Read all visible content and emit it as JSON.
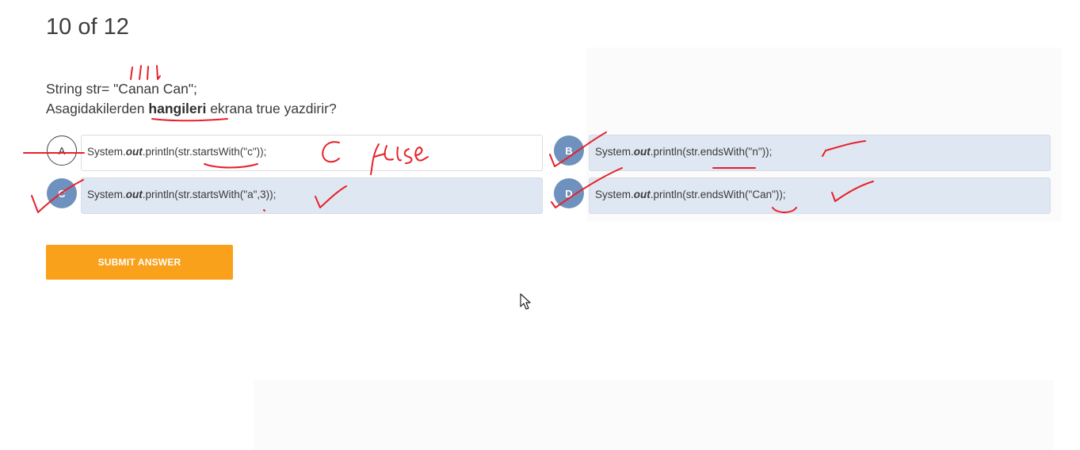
{
  "progress": {
    "current": "10",
    "of": "of",
    "total": "12"
  },
  "question": {
    "line1": "String str= \"Canan Can\";",
    "line2_before": "Asagidakilerden ",
    "line2_bold": "hangileri",
    "line2_after": " ekrana true yazdirir?"
  },
  "options": [
    {
      "letter": "A",
      "code_prefix": "System.",
      "code_italic": "out",
      "code_suffix": ".println(str.startsWith(\"c\"));",
      "selected": false
    },
    {
      "letter": "B",
      "code_prefix": "System.",
      "code_italic": "out",
      "code_suffix": ".println(str.endsWith(\"n\"));",
      "selected": true
    },
    {
      "letter": "C",
      "code_prefix": "System.",
      "code_italic": "out",
      "code_suffix": ".println(str.startsWith(\"a\",3));",
      "selected": true
    },
    {
      "letter": "D",
      "code_prefix": "System.",
      "code_italic": "out",
      "code_suffix": ".println(str.endsWith(\"Can\"));",
      "selected": true
    }
  ],
  "submit": {
    "label": "SUBMIT ANSWER"
  },
  "colors": {
    "accent": "#f9a11b",
    "selected_circle": "#6e91bd",
    "selected_box": "#dfe7f2",
    "ink": "#e8202a"
  },
  "icons": {
    "cursor": "mouse-pointer-icon"
  }
}
